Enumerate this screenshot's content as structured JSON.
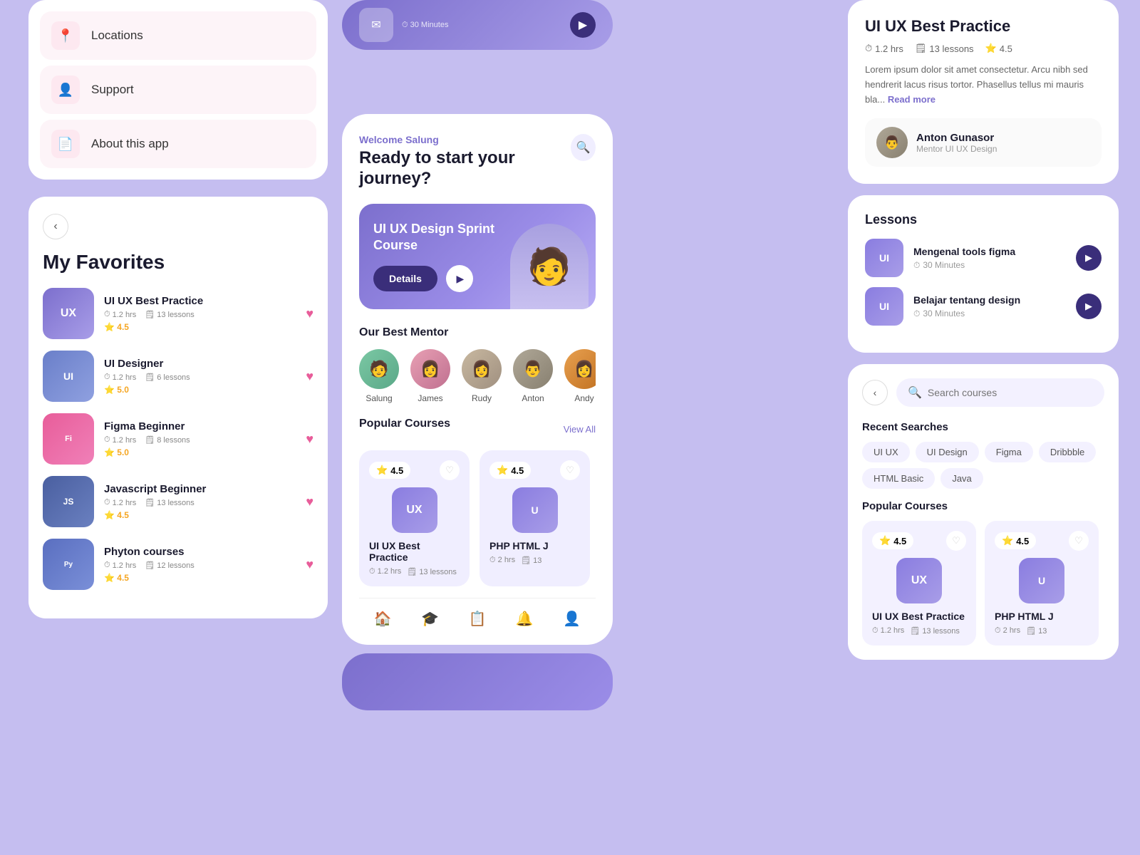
{
  "app": {
    "bg_color": "#c5bef0"
  },
  "left": {
    "menu": {
      "items": [
        {
          "id": "locations",
          "icon": "📍",
          "label": "Locations"
        },
        {
          "id": "support",
          "icon": "👤",
          "label": "Support"
        },
        {
          "id": "about",
          "icon": "📄",
          "label": "About this app"
        }
      ]
    },
    "favorites": {
      "title": "My Favorites",
      "back_label": "‹",
      "items": [
        {
          "name": "UI UX Best Practice",
          "hours": "1.2 hrs",
          "lessons": "13 lessons",
          "rating": "4.5",
          "thumb_type": "purple",
          "thumb_label": "UX"
        },
        {
          "name": "UI Designer",
          "hours": "1.2 hrs",
          "lessons": "6 lessons",
          "rating": "5.0",
          "thumb_type": "blue",
          "thumb_label": "UI"
        },
        {
          "name": "Figma Beginner",
          "hours": "1.2 hrs",
          "lessons": "8 lessons",
          "rating": "5.0",
          "thumb_type": "pink",
          "thumb_label": "Fi"
        },
        {
          "name": "Javascript Beginner",
          "hours": "1.2 hrs",
          "lessons": "13 lessons",
          "rating": "4.5",
          "thumb_type": "dark",
          "thumb_label": "JS"
        },
        {
          "name": "Phyton courses",
          "hours": "1.2 hrs",
          "lessons": "12 lessons",
          "rating": "4.5",
          "thumb_type": "indigo",
          "thumb_label": "Py"
        }
      ]
    }
  },
  "center": {
    "phone": {
      "welcome": "Welcome Salung",
      "title": "Ready to start your journey?",
      "banner": {
        "title": "UI UX Design Sprint Course",
        "btn_label": "Details",
        "play_label": "▶"
      },
      "mentors_section": "Our Best Mentor",
      "mentors": [
        {
          "name": "Salung",
          "style": "avatar-s"
        },
        {
          "name": "James",
          "style": "avatar-j"
        },
        {
          "name": "Rudy",
          "style": "avatar-r"
        },
        {
          "name": "Anton",
          "style": "avatar-a"
        },
        {
          "name": "Andy",
          "style": "avatar-an"
        }
      ],
      "popular_section": "Popular Courses",
      "view_all": "View All",
      "courses": [
        {
          "name": "UI UX Best Practice",
          "rating": "4.5",
          "hours": "1.2 hrs",
          "lessons": "13 lessons",
          "thumb_label": "UX"
        },
        {
          "name": "PHP HTML J",
          "rating": "4.5",
          "hours": "2 hrs",
          "lessons": "13",
          "thumb_label": "U"
        }
      ],
      "nav_items": [
        "🏠",
        "🎓",
        "📋",
        "🔔",
        "👤"
      ]
    }
  },
  "right": {
    "detail": {
      "title": "UI UX Best Practice",
      "hours": "1.2 hrs",
      "lessons": "13 lessons",
      "rating": "4.5",
      "desc": "Lorem ipsum dolor sit amet consectetur. Arcu nibh sed hendrerit lacus risus tortor. Phasellus tellus mi mauris bla...",
      "read_more": "Read more",
      "mentor_name": "Anton Gunasor",
      "mentor_role": "Mentor UI UX Design"
    },
    "lessons": {
      "title": "Lessons",
      "items": [
        {
          "name": "Mengenal tools figma",
          "duration": "30 Minutes",
          "thumb_label": "UI"
        },
        {
          "name": "Belajar tentang design",
          "duration": "30 Minutes",
          "thumb_label": "UI"
        }
      ]
    },
    "search": {
      "placeholder": "Search courses",
      "recent_title": "Recent Searches",
      "tags": [
        "UI UX",
        "UI Design",
        "Figma",
        "Dribbble",
        "HTML Basic",
        "Java"
      ],
      "popular_title": "Popular Courses",
      "courses": [
        {
          "name": "UI UX Best Practice",
          "rating": "4.5",
          "hours": "1.2 hrs",
          "lessons": "13 lessons",
          "thumb_label": "UX"
        },
        {
          "name": "PHP HTML J",
          "rating": "4.5",
          "hours": "2 hrs",
          "lessons": "13",
          "thumb_label": "U"
        }
      ]
    }
  }
}
